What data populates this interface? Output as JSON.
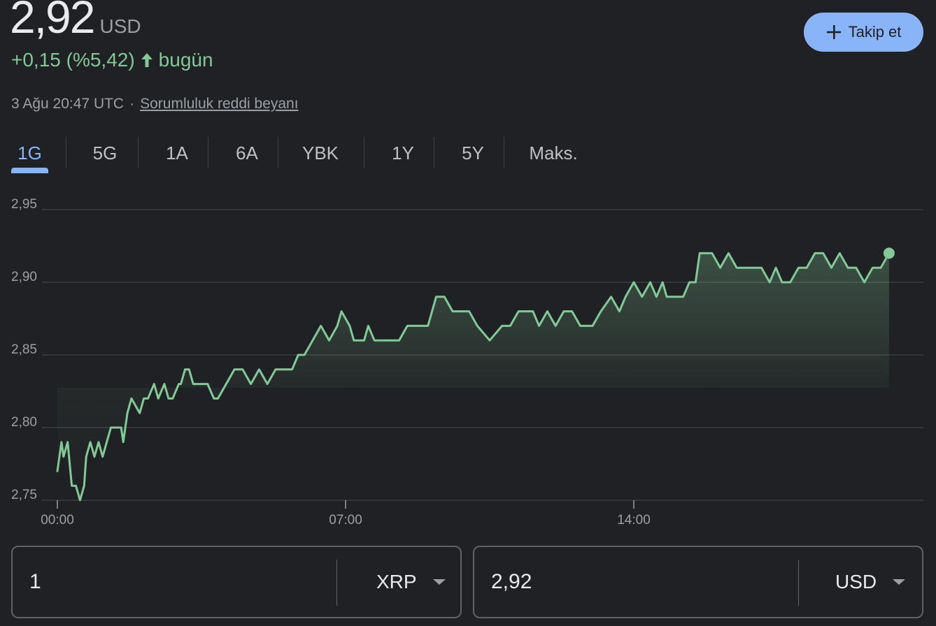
{
  "header": {
    "price": "2,92",
    "currency": "USD",
    "change": "+0,15 (%5,42)",
    "change_period": "bugün",
    "timestamp": "3 Ağu 20:47 UTC",
    "separator": "·",
    "disclaimer": "Sorumluluk reddi beyanı",
    "follow_label": "Takip et"
  },
  "tabs": [
    {
      "label": "1G",
      "active": true
    },
    {
      "label": "5G"
    },
    {
      "label": "1A"
    },
    {
      "label": "6A"
    },
    {
      "label": "YBK"
    },
    {
      "label": "1Y"
    },
    {
      "label": "5Y"
    },
    {
      "label": "Maks."
    }
  ],
  "colors": {
    "positive": "#81c995",
    "accent": "#8ab4f8",
    "background": "#202124",
    "grid": "#3c4043"
  },
  "chart_data": {
    "type": "line",
    "xlabel": "",
    "ylabel": "",
    "y_tick_labels": [
      "2,75",
      "2,80",
      "2,85",
      "2,90",
      "2,95"
    ],
    "y_ticks": [
      2.75,
      2.8,
      2.85,
      2.9,
      2.95
    ],
    "x_tick_labels": [
      "00:00",
      "07:00",
      "14:00"
    ],
    "ylim": [
      2.75,
      2.95
    ],
    "x_range_hours": [
      0,
      24
    ],
    "grid": true,
    "series": [
      {
        "x": [
          0.0,
          0.1,
          0.15,
          0.25,
          0.35,
          0.45,
          0.55,
          0.65,
          0.7,
          0.8,
          0.9,
          1.0,
          1.1,
          1.2,
          1.3,
          1.4,
          1.45,
          1.55,
          1.6,
          1.7,
          1.8,
          2.0,
          2.1,
          2.2,
          2.35,
          2.45,
          2.6,
          2.7,
          2.8,
          2.95,
          3.0,
          3.1,
          3.2,
          3.3,
          3.4,
          3.5,
          3.65,
          3.8,
          3.9,
          4.1,
          4.3,
          4.5,
          4.7,
          4.9,
          5.1,
          5.3,
          5.5,
          5.7,
          5.85,
          6.0,
          6.2,
          6.4,
          6.6,
          6.8,
          6.9,
          7.1,
          7.2,
          7.3,
          7.45,
          7.55,
          7.7,
          7.85,
          7.95,
          8.1,
          8.3,
          8.5,
          8.65,
          8.8,
          9.0,
          9.2,
          9.4,
          9.6,
          9.8,
          10.0,
          10.2,
          10.5,
          10.8,
          11.0,
          11.2,
          11.4,
          11.55,
          11.7,
          11.9,
          12.1,
          12.3,
          12.5,
          12.7,
          12.85,
          13.0,
          13.2,
          13.45,
          13.65,
          13.8,
          14.0,
          14.2,
          14.4,
          14.55,
          14.7,
          14.8,
          14.95,
          15.1,
          15.2,
          15.35,
          15.5,
          15.6,
          15.75,
          15.9,
          16.1,
          16.3,
          16.5,
          16.7,
          16.9,
          17.1,
          17.3,
          17.45,
          17.6,
          17.8,
          18.0,
          18.2,
          18.4,
          18.6,
          18.8,
          19.0,
          19.2,
          19.4,
          19.6,
          19.8,
          20.0,
          20.2
        ],
        "values": [
          2.77,
          2.79,
          2.78,
          2.79,
          2.76,
          2.76,
          2.75,
          2.76,
          2.78,
          2.79,
          2.78,
          2.79,
          2.78,
          2.79,
          2.8,
          2.8,
          2.8,
          2.8,
          2.79,
          2.81,
          2.82,
          2.81,
          2.82,
          2.82,
          2.83,
          2.82,
          2.83,
          2.82,
          2.82,
          2.83,
          2.83,
          2.84,
          2.84,
          2.83,
          2.83,
          2.83,
          2.83,
          2.82,
          2.82,
          2.83,
          2.84,
          2.84,
          2.83,
          2.84,
          2.83,
          2.84,
          2.84,
          2.84,
          2.85,
          2.85,
          2.86,
          2.87,
          2.86,
          2.87,
          2.88,
          2.87,
          2.86,
          2.86,
          2.86,
          2.87,
          2.86,
          2.86,
          2.86,
          2.86,
          2.86,
          2.87,
          2.87,
          2.87,
          2.87,
          2.89,
          2.89,
          2.88,
          2.88,
          2.88,
          2.87,
          2.86,
          2.87,
          2.87,
          2.88,
          2.88,
          2.88,
          2.87,
          2.88,
          2.87,
          2.88,
          2.88,
          2.87,
          2.87,
          2.87,
          2.88,
          2.89,
          2.88,
          2.89,
          2.9,
          2.89,
          2.9,
          2.89,
          2.9,
          2.89,
          2.89,
          2.89,
          2.89,
          2.9,
          2.9,
          2.92,
          2.92,
          2.92,
          2.91,
          2.92,
          2.91,
          2.91,
          2.91,
          2.91,
          2.9,
          2.91,
          2.9,
          2.9,
          2.91,
          2.91,
          2.92,
          2.92,
          2.91,
          2.92,
          2.91,
          2.91,
          2.9,
          2.91,
          2.91,
          2.92
        ]
      }
    ]
  },
  "converter": {
    "from_value": "1",
    "from_currency": "XRP",
    "to_value": "2,92",
    "to_currency": "USD"
  }
}
